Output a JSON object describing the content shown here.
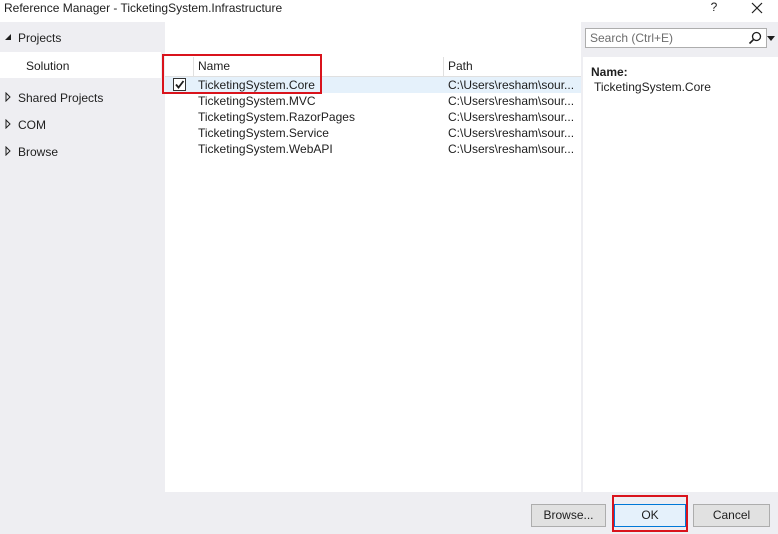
{
  "window": {
    "title": "Reference Manager - TicketingSystem.Infrastructure",
    "help_label": "?",
    "close_icon": "close-icon"
  },
  "sidebar": {
    "items": [
      {
        "label": "Projects",
        "expanded": true
      },
      {
        "label": "Solution",
        "selected": true
      },
      {
        "label": "Shared Projects",
        "expanded": false
      },
      {
        "label": "COM",
        "expanded": false
      },
      {
        "label": "Browse",
        "expanded": false
      }
    ]
  },
  "search": {
    "placeholder": "Search (Ctrl+E)"
  },
  "list": {
    "columns": {
      "name": "Name",
      "path": "Path"
    },
    "rows": [
      {
        "name": "TicketingSystem.Core",
        "path": "C:\\Users\\resham\\sour...",
        "checked": true
      },
      {
        "name": "TicketingSystem.MVC",
        "path": "C:\\Users\\resham\\sour...",
        "checked": false
      },
      {
        "name": "TicketingSystem.RazorPages",
        "path": "C:\\Users\\resham\\sour...",
        "checked": false
      },
      {
        "name": "TicketingSystem.Service",
        "path": "C:\\Users\\resham\\sour...",
        "checked": false
      },
      {
        "name": "TicketingSystem.WebAPI",
        "path": "C:\\Users\\resham\\sour...",
        "checked": false
      }
    ]
  },
  "details": {
    "name_label": "Name:",
    "name_value": "TicketingSystem.Core"
  },
  "footer": {
    "browse_label": "Browse...",
    "ok_label": "OK",
    "cancel_label": "Cancel"
  },
  "colors": {
    "highlight": "#d9131c",
    "selection": "#e5f1fb",
    "accent": "#0078d7"
  }
}
